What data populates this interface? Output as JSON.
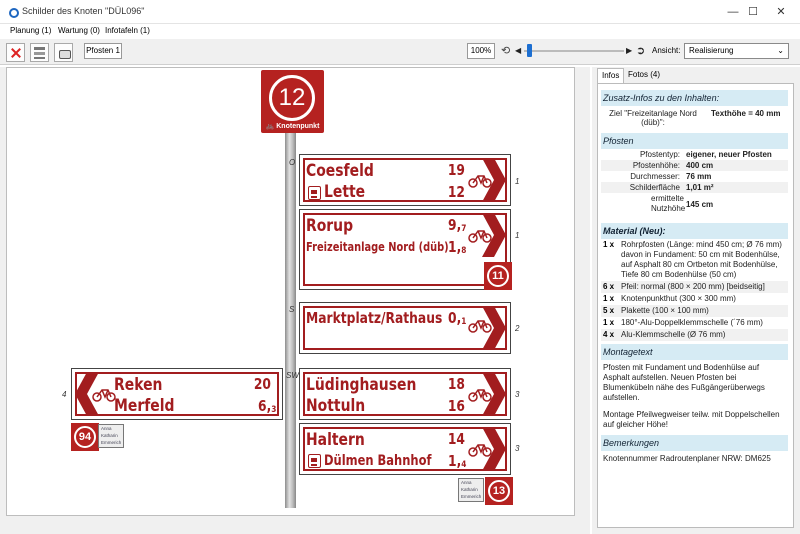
{
  "window": {
    "title": "Schilder des Knoten \"DÜL096\"",
    "minimize": "—",
    "maximize": "☐",
    "close": "✕"
  },
  "menu_tabs": [
    "Planung (1)",
    "Wartung (0)",
    "Infotafeln (1)"
  ],
  "toolbar": {
    "post_tab": "Pfosten 1",
    "zoom": "100%",
    "view_label": "Ansicht:",
    "view_value": "Realisierung"
  },
  "canvas": {
    "knotenpunkt_top": {
      "number": "12",
      "label": "Knotenpunkt"
    },
    "direction_labels": {
      "o": "O",
      "s": "S",
      "sw": "SW"
    },
    "signs": [
      {
        "id": "coesfeld",
        "rows": [
          {
            "place": "Coesfeld",
            "dist": "19"
          },
          {
            "place": "Lette",
            "dist": "12",
            "bus": true
          }
        ],
        "side": "1"
      },
      {
        "id": "rorup",
        "rows": [
          {
            "place": "Rorup",
            "dist_int": "9",
            "dist_dec": "7"
          },
          {
            "place": "Freizeitanlage Nord (düb)",
            "dist_int": "1",
            "dist_dec": "8"
          }
        ],
        "side": "1",
        "badge": "11"
      },
      {
        "id": "marktplatz",
        "rows": [
          {
            "place": "Marktplatz/Rathaus",
            "dist_int": "0",
            "dist_dec": "1"
          }
        ],
        "side": "2"
      },
      {
        "id": "reken",
        "rows": [
          {
            "place": "Reken",
            "dist": "20"
          },
          {
            "place": "Merfeld",
            "dist_int": "6",
            "dist_dec": "3"
          }
        ],
        "side": "4",
        "badge": "94"
      },
      {
        "id": "luedinghausen",
        "rows": [
          {
            "place": "Lüdinghausen",
            "dist": "18"
          },
          {
            "place": "Nottuln",
            "dist": "16"
          }
        ],
        "side": "3"
      },
      {
        "id": "haltern",
        "rows": [
          {
            "place": "Haltern",
            "dist": "14"
          },
          {
            "place": "Dülmen Bahnhof",
            "dist_int": "1",
            "dist_dec": "4",
            "bus": true
          }
        ],
        "side": "3",
        "badge": "13"
      }
    ],
    "plaque_lines": [
      "Anna",
      "Katharin",
      "Emmerich"
    ]
  },
  "panel": {
    "tabs": [
      "Infos",
      "Fotos (4)"
    ],
    "sections": {
      "zusatz": {
        "title": "Zusatz-Infos zu den Inhalten:",
        "key": "Ziel \"Freizeitanlage Nord (düb)\":",
        "value": "Texthöhe = 40 mm"
      },
      "pfosten": {
        "title": "Pfosten",
        "rows": [
          {
            "k": "Pfostentyp:",
            "v": "eigener, neuer Pfosten"
          },
          {
            "k": "Pfostenhöhe:",
            "v": "400 cm"
          },
          {
            "k": "Durchmesser:",
            "v": "76 mm"
          },
          {
            "k": "Schilderfläche",
            "v": "1,01 m²"
          },
          {
            "k": "ermittelte Nutzhöhe",
            "v": "145 cm"
          }
        ]
      },
      "material": {
        "title": "Material (Neu):",
        "rows": [
          {
            "q": "1 x",
            "t": "Rohrpfosten (Länge: mind 450 cm; Ø 76 mm) davon in Fundament: 50 cm mit Bodenhülse, auf Asphalt 80 cm Ortbeton mit Bodenhülse, Tiefe 80 cm Bodenhülse (50 cm)"
          },
          {
            "q": "6 x",
            "t": "Pfeil: normal (800 × 200 mm) [beidseitig]"
          },
          {
            "q": "1 x",
            "t": "Knotenpunkthut (300 × 300 mm)"
          },
          {
            "q": "5 x",
            "t": "Plakette (100 × 100 mm)"
          },
          {
            "q": "1 x",
            "t": "180°-Alu-Doppelklemmschelle (´76 mm)"
          },
          {
            "q": "4 x",
            "t": "Alu-Klemmschelle (Ø 76 mm)"
          }
        ]
      },
      "montage": {
        "title": "Montagetext",
        "text1": "Pfosten mit Fundament und Bodenhülse auf Asphalt aufstellen. Neuen Pfosten bei Blumenkübeln nähe des Fußgängerüberwegs aufstellen.",
        "text2": "Montage Pfeilwegweiser teilw. mit Doppelschellen auf gleicher Höhe!"
      },
      "bemerkungen": {
        "title": "Bemerkungen",
        "text": "Knotennummer Radroutenplaner NRW: DM625"
      }
    }
  },
  "colors": {
    "sign_red": "#a21d1f",
    "badge_red": "#b52220",
    "section_blue": "#d6ebf4"
  }
}
